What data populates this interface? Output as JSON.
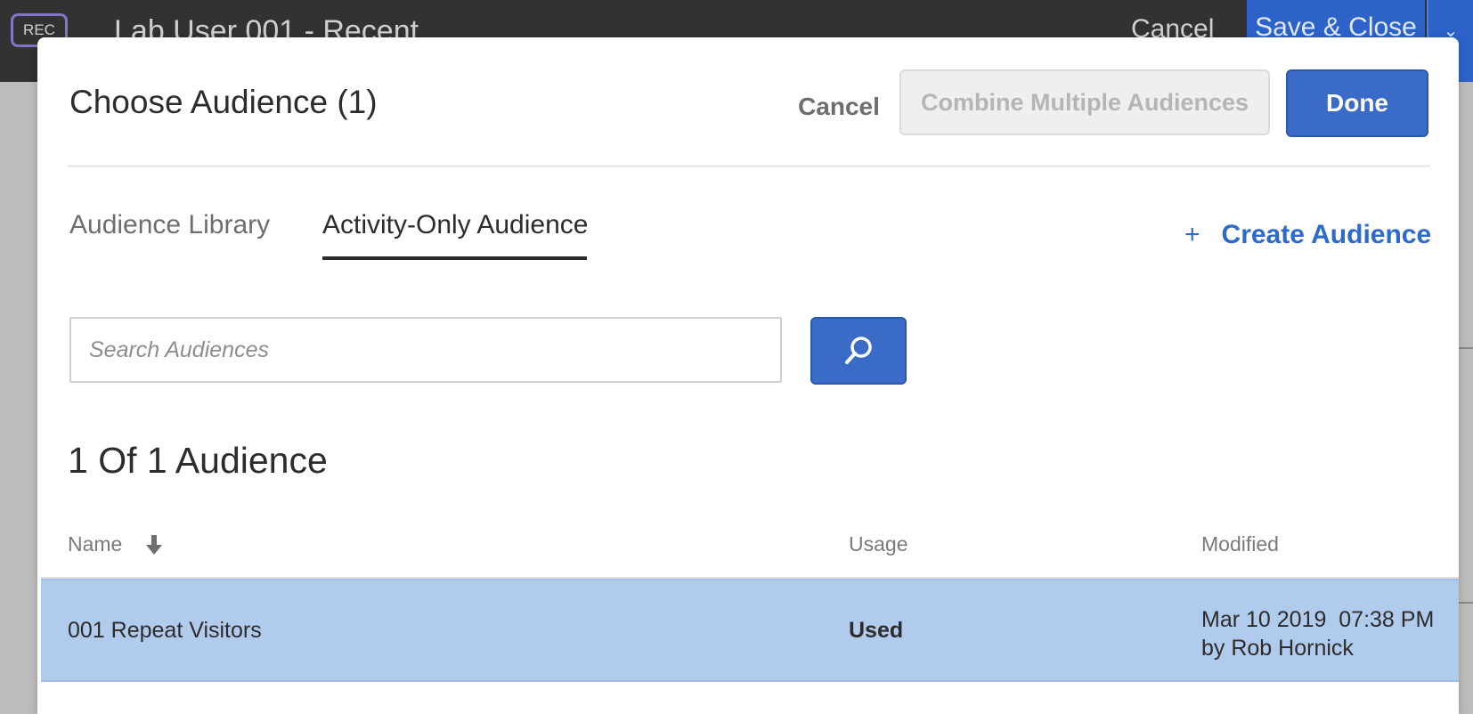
{
  "background": {
    "rec_badge": "REC",
    "title": "Lab User 001 - Recent",
    "cancel_label": "Cancel",
    "save_close_label": "Save & Close",
    "dropdown_icon": "chevron-down-icon"
  },
  "dialog": {
    "title": "Choose Audience (1)",
    "cancel_label": "Cancel",
    "combine_label": "Combine Multiple Audiences",
    "done_label": "Done"
  },
  "tabs": [
    {
      "label": "Audience Library",
      "active": false
    },
    {
      "label": "Activity-Only Audience",
      "active": true
    }
  ],
  "create_audience": {
    "icon": "+",
    "label": "Create Audience"
  },
  "search": {
    "placeholder": "Search Audiences",
    "value": "",
    "icon": "search-icon"
  },
  "results": {
    "count_label": "1 Of 1 Audience",
    "columns": {
      "name": "Name",
      "usage": "Usage",
      "modified": "Modified"
    },
    "rows": [
      {
        "name": "001 Repeat Visitors",
        "usage": "Used",
        "modified_date": "Mar 10 2019  07:38 PM",
        "modified_by": "by Rob Hornick",
        "selected": true
      }
    ]
  },
  "colors": {
    "primary": "#3a6bc6",
    "link": "#2d6acb",
    "selected_row": "#b1cbed",
    "rec_border": "#8474c4"
  }
}
